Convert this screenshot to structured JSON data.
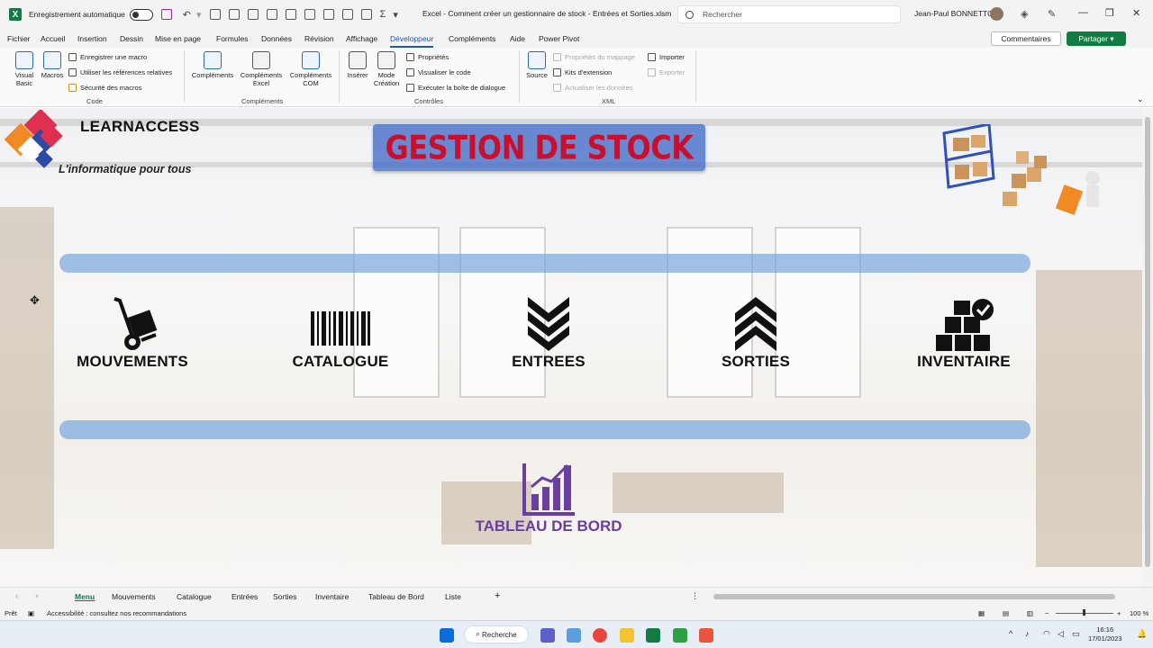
{
  "window": {
    "autosave_label": "Enregistrement automatique",
    "doc_title": "Excel - Comment créer un gestionnaire de stock - Entrées et Sorties.xlsm",
    "search_placeholder": "Rechercher",
    "user_name": "Jean-Paul BONNETTO"
  },
  "ribbon_tabs": [
    "Fichier",
    "Accueil",
    "Insertion",
    "Dessin",
    "Mise en page",
    "Formules",
    "Données",
    "Révision",
    "Affichage",
    "Développeur",
    "Compléments",
    "Aide",
    "Power Pivot"
  ],
  "active_tab": "Développeur",
  "ribbon_actions": {
    "comments": "Commentaires",
    "share": "Partager"
  },
  "ribbon": {
    "code": {
      "label": "Code",
      "visual_basic": "Visual Basic",
      "macros": "Macros",
      "record": "Enregistrer une macro",
      "relative": "Utiliser les références relatives",
      "security": "Sécurité des macros"
    },
    "addins": {
      "label": "Compléments",
      "complements": "Compléments",
      "excel": "Compléments Excel",
      "com": "Compléments COM"
    },
    "controls": {
      "label": "Contrôles",
      "insert": "Insérer",
      "design": "Mode Création",
      "properties": "Propriétés",
      "view_code": "Visualiser le code",
      "run_dialog": "Exécuter la boîte de dialogue"
    },
    "xml": {
      "label": "XML",
      "source": "Source",
      "map_props": "Propriétés du mappage",
      "ext_packs": "Kits d'extension",
      "refresh": "Actualiser les données",
      "import": "Importer",
      "export": "Exporter"
    }
  },
  "sheet": {
    "brand": "LEARNACCESS",
    "tagline": "L'informatique pour tous",
    "title": "GESTION DE STOCK",
    "menu": [
      {
        "label": "MOUVEMENTS",
        "icon": "hand-truck-icon"
      },
      {
        "label": "CATALOGUE",
        "icon": "barcode-icon"
      },
      {
        "label": "ENTREES",
        "icon": "chevrons-down-icon"
      },
      {
        "label": "SORTIES",
        "icon": "chevrons-up-icon"
      },
      {
        "label": "INVENTAIRE",
        "icon": "boxes-check-icon"
      }
    ],
    "dashboard": {
      "label": "TABLEAU DE BORD",
      "icon": "bar-chart-icon"
    },
    "colors": {
      "title": "#c8102e",
      "title_box": "#466ec8",
      "band": "#6ea0dc",
      "dashboard": "#6b3fa0"
    }
  },
  "sheet_tabs": [
    "Menu",
    "Mouvements",
    "Catalogue",
    "Entrées",
    "Sorties",
    "Inventaire",
    "Tableau de Bord",
    "Liste"
  ],
  "active_sheet": "Menu",
  "status": {
    "ready": "Prêt",
    "accessibility": "Accessibilité : consultez nos recommandations",
    "zoom": "100 %"
  },
  "taskbar": {
    "search": "Recherche",
    "time": "16:16",
    "date": "17/01/2023"
  }
}
